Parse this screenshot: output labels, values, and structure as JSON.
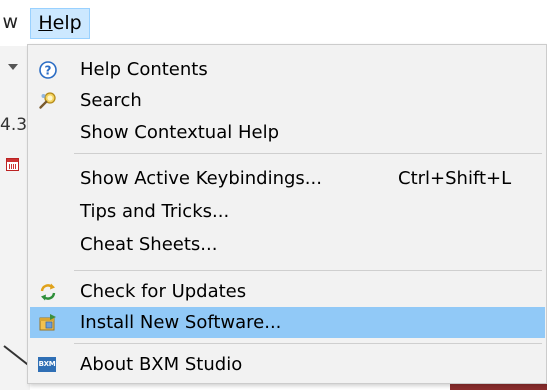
{
  "menubar": {
    "previous_menu_fragment": "w",
    "help_menu": {
      "mnemonic": "H",
      "rest": "elp"
    }
  },
  "background": {
    "toolbar_text_fragment": "4.3"
  },
  "help_menu": {
    "items": [
      {
        "label": "Help Contents",
        "icon": "help-contents-icon",
        "shortcut": ""
      },
      {
        "label": "Search",
        "icon": "search-icon",
        "shortcut": ""
      },
      {
        "label": "Show Contextual Help",
        "icon": "",
        "shortcut": ""
      },
      {
        "label": "Show Active Keybindings...",
        "icon": "",
        "shortcut": "Ctrl+Shift+L"
      },
      {
        "label": "Tips and Tricks...",
        "icon": "",
        "shortcut": ""
      },
      {
        "label": "Cheat Sheets...",
        "icon": "",
        "shortcut": ""
      },
      {
        "label": "Check for Updates",
        "icon": "check-updates-icon",
        "shortcut": ""
      },
      {
        "label": "Install New Software...",
        "icon": "install-software-icon",
        "shortcut": "",
        "highlighted": true
      },
      {
        "label": "About BXM Studio",
        "icon": "bxm-logo-icon",
        "badge_text": "BXM",
        "shortcut": ""
      }
    ]
  },
  "colors": {
    "menu_background": "#f2f2f2",
    "highlight": "#91c9f7",
    "menubar_active": "#cce8ff",
    "separator": "#cfcfcf"
  }
}
